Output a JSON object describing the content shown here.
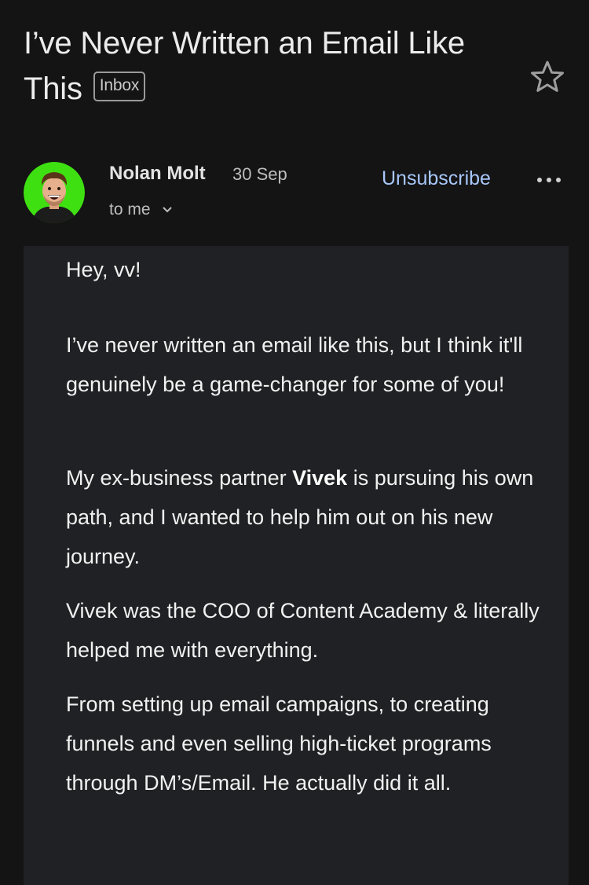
{
  "email": {
    "subject": "I’ve Never Written an Email Like This",
    "label_badge": "Inbox",
    "sender": {
      "name": "Nolan Molt",
      "date": "30 Sep",
      "recipient": "to me"
    },
    "actions": {
      "unsubscribe": "Unsubscribe",
      "star_icon": "star-outline-icon",
      "more_icon": "more-horizontal-icon"
    },
    "body": {
      "greeting": "Hey, vv!",
      "p1": "I’ve never written an email like this, but I think it'll genuinely be a game-changer for some of you!",
      "p2_pre": "My ex-business partner ",
      "p2_bold": "Vivek",
      "p2_post": " is pursuing his own path, and I wanted to help him out on his new journey.",
      "p3": "Vivek was the COO of Content Academy & literally helped me with everything.",
      "p4": "From setting up email campaigns, to creating funnels and even selling high-ticket programs through DM’s/Email. He actually did it all."
    }
  },
  "colors": {
    "background": "#141414",
    "body_card": "#202124",
    "link": "#a8c7fa",
    "avatar_bg": "#3fe012"
  }
}
